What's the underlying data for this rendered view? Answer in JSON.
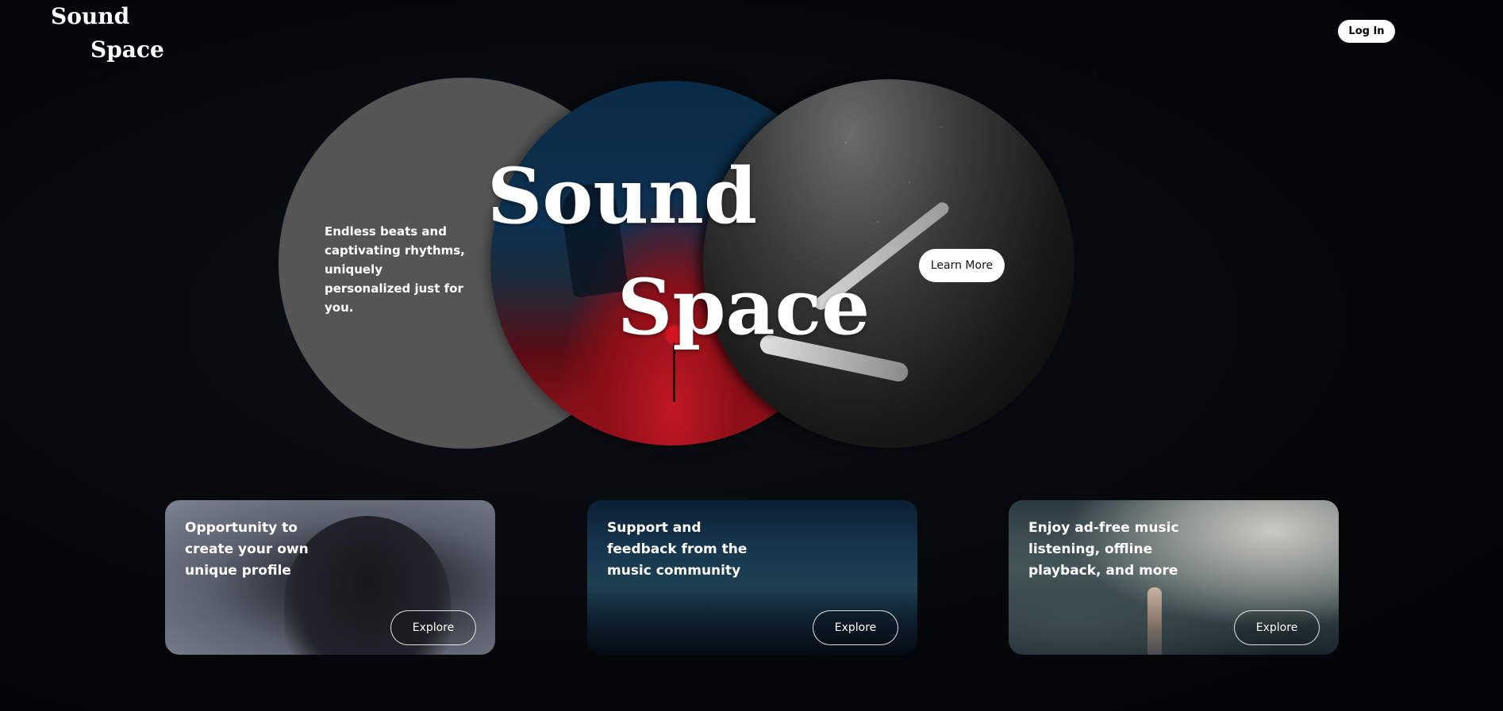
{
  "header": {
    "logo_line1": "Sound",
    "logo_line2": "Space",
    "login_label": "Log In"
  },
  "hero": {
    "tagline": "Endless beats and captivating rhythms, uniquely personalized just for you.",
    "title_line1": "Sound",
    "title_line2": "Space",
    "learn_more_label": "Learn More"
  },
  "cards": [
    {
      "text": "Opportunity to create your own unique profile",
      "button_label": "Explore"
    },
    {
      "text": "Support and feedback from the music community",
      "button_label": "Explore"
    },
    {
      "text": "Enjoy ad-free music listening, offline playback, and more",
      "button_label": "Explore"
    }
  ],
  "colors": {
    "background": "#05070b",
    "grey_circle": "#555555",
    "accent_red": "#c01824",
    "button_bg": "#ffffff"
  }
}
